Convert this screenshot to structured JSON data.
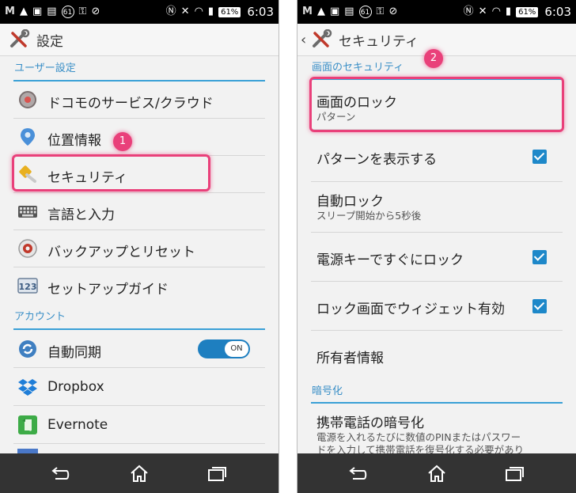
{
  "left": {
    "status_bar": {
      "battery": "61%",
      "time": "6:03",
      "badge": "61"
    },
    "title": "設定",
    "section_user": "ユーザー設定",
    "items": [
      {
        "label": "ドコモのサービス/クラウド",
        "icon": "docomo-service-icon"
      },
      {
        "label": "位置情報",
        "icon": "location-pin-icon"
      },
      {
        "label": "セキュリティ",
        "icon": "security-key-icon"
      },
      {
        "label": "言語と入力",
        "icon": "keyboard-icon"
      },
      {
        "label": "バックアップとリセット",
        "icon": "backup-reset-icon"
      },
      {
        "label": "セットアップガイド",
        "icon": "setup-guide-icon"
      }
    ],
    "section_account": "アカウント",
    "accounts": [
      {
        "label": "自動同期",
        "icon": "sync-icon",
        "toggle": "ON"
      },
      {
        "label": "Dropbox",
        "icon": "dropbox-icon"
      },
      {
        "label": "Evernote",
        "icon": "evernote-icon"
      }
    ],
    "step_badge": "1"
  },
  "right": {
    "status_bar": {
      "battery": "61%",
      "time": "6:03",
      "badge": "61"
    },
    "title": "セキュリティ",
    "section_screen": "画面のセキュリティ",
    "screen_lock": {
      "title": "画面のロック",
      "summary": "パターン"
    },
    "show_pattern": {
      "title": "パターンを表示する",
      "checked": true
    },
    "auto_lock": {
      "title": "自動ロック",
      "summary": "スリープ開始から5秒後"
    },
    "power_lock": {
      "title": "電源キーですぐにロック",
      "checked": true
    },
    "lock_widget": {
      "title": "ロック画面でウィジェット有効",
      "checked": true
    },
    "owner_info": {
      "title": "所有者情報"
    },
    "section_encrypt": "暗号化",
    "encrypt": {
      "title": "携帯電話の暗号化",
      "summary_line1": "電源を入れるたびに数値のPINまたはパスワー",
      "summary_line2": "ドを入力して携帯電話を復号化する必要があり"
    },
    "step_badge": "2"
  },
  "colors": {
    "accent": "#3a8fc7",
    "highlight": "#e9407a",
    "checkbox": "#1e88c9",
    "navbar": "#333333"
  }
}
